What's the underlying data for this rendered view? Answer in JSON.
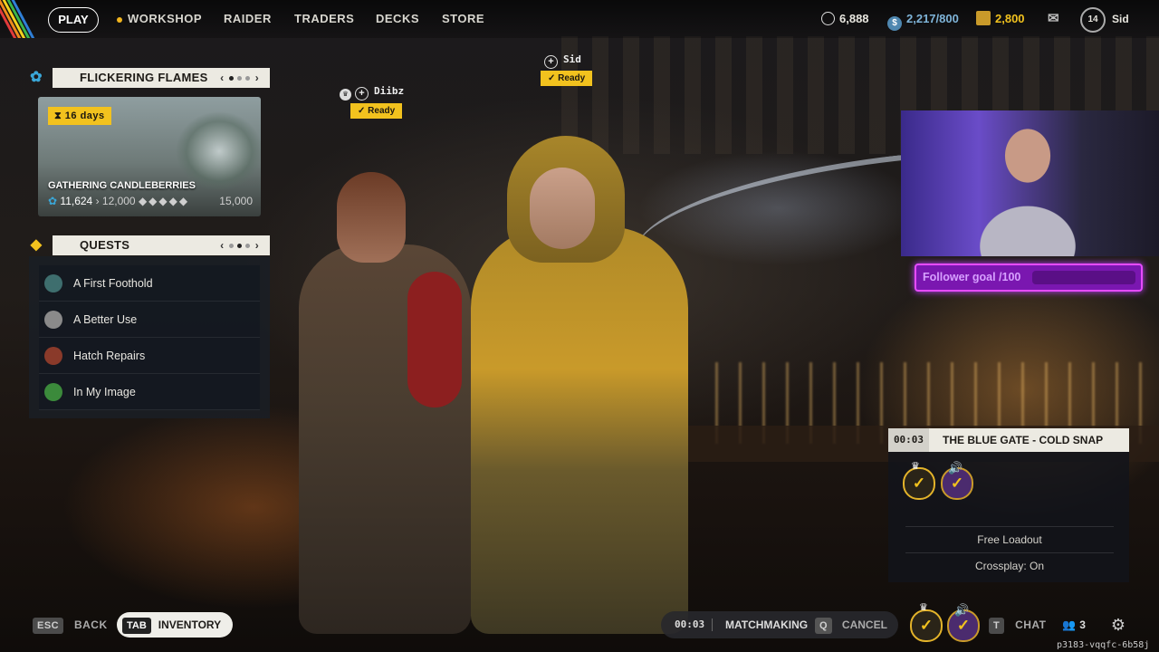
{
  "nav": {
    "play": "PLAY",
    "workshop": "WORKSHOP",
    "raider": "RAIDER",
    "traders": "TRADERS",
    "decks": "DECKS",
    "store": "STORE"
  },
  "currencies": {
    "silver": "6,888",
    "credits": "2,217/800",
    "coins": "2,800"
  },
  "profile": {
    "level": "14",
    "name": "Sid"
  },
  "event": {
    "header": "FLICKERING FLAMES",
    "days": "16 days",
    "title": "GATHERING CANDLEBERRIES",
    "current": "11,624",
    "milestone": "12,000",
    "max": "15,000",
    "page_prev": "‹",
    "page_next": "›"
  },
  "quests": {
    "header": "QUESTS",
    "items": [
      "A First Foothold",
      "A Better Use",
      "Hatch Repairs",
      "In My Image"
    ]
  },
  "party": [
    {
      "name": "Diibz",
      "status": "Ready"
    },
    {
      "name": "Sid",
      "status": "Ready"
    }
  ],
  "stream": {
    "goal_text": "Follower goal /100"
  },
  "match": {
    "timer": "00:03",
    "map": "THE BLUE GATE - COLD SNAP",
    "loadout": "Free Loadout",
    "crossplay": "Crossplay: On"
  },
  "bottom": {
    "esc_key": "ESC",
    "back": "BACK",
    "tab_key": "TAB",
    "inventory": "INVENTORY",
    "mm_timer": "00:03",
    "matchmaking": "MATCHMAKING",
    "q_key": "Q",
    "cancel": "CANCEL",
    "t_key": "T",
    "chat": "CHAT",
    "party_count": "3",
    "session_id": "p3183-vqqfc-6b58j"
  },
  "colors": {
    "accent": "#f2c21e",
    "panel_header": "#eceae2",
    "goal": "#e64bff"
  }
}
